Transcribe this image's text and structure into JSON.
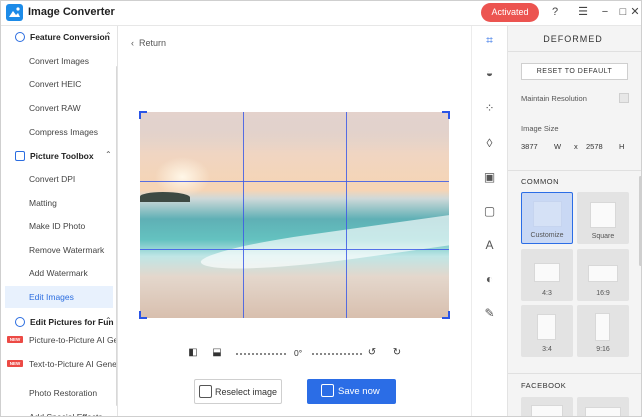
{
  "app": {
    "title": "Image Converter",
    "activated_label": "Activated"
  },
  "window_controls": {
    "help": "?",
    "menu": "☰",
    "minimize": "−",
    "maximize": "□",
    "close": "✕"
  },
  "sidebar": {
    "sections": [
      {
        "label": "Feature Conversion",
        "items": [
          "Convert Images",
          "Convert HEIC",
          "Convert RAW",
          "Compress Images"
        ]
      },
      {
        "label": "Picture Toolbox",
        "items": [
          "Convert DPI",
          "Matting",
          "Make ID Photo",
          "Remove Watermark",
          "Add Watermark",
          "Edit Images"
        ]
      },
      {
        "label": "Edit Pictures for Fun",
        "items": [
          "Picture-to-Picture AI Generator",
          "Text-to-Picture AI Generator",
          "Photo Restoration",
          "Add Special Effects"
        ]
      }
    ],
    "active_item": "Edit Images",
    "new_badge": "NEW"
  },
  "main": {
    "return_label": "Return",
    "rotation_angle": "0°",
    "reselect_label": "Reselect image",
    "save_label": "Save now"
  },
  "panel": {
    "title": "DEFORMED",
    "reset_label": "RESET TO DEFAULT",
    "maintain_resolution_label": "Maintain Resolution",
    "maintain_resolution_checked": false,
    "image_size_label": "Image Size",
    "width": "3877",
    "width_unit": "W",
    "times": "x",
    "height": "2578",
    "height_unit": "H",
    "common_label": "COMMON",
    "presets": [
      {
        "label": "Customize",
        "selected": true
      },
      {
        "label": "Square",
        "selected": false
      },
      {
        "label": "4:3",
        "selected": false
      },
      {
        "label": "16:9",
        "selected": false
      },
      {
        "label": "3:4",
        "selected": false
      },
      {
        "label": "9:16",
        "selected": false
      }
    ],
    "facebook_label": "FACEBOOK"
  },
  "colors": {
    "accent": "#2b6de6",
    "activated": "#ec5450",
    "grid": "#3c5ae6"
  }
}
